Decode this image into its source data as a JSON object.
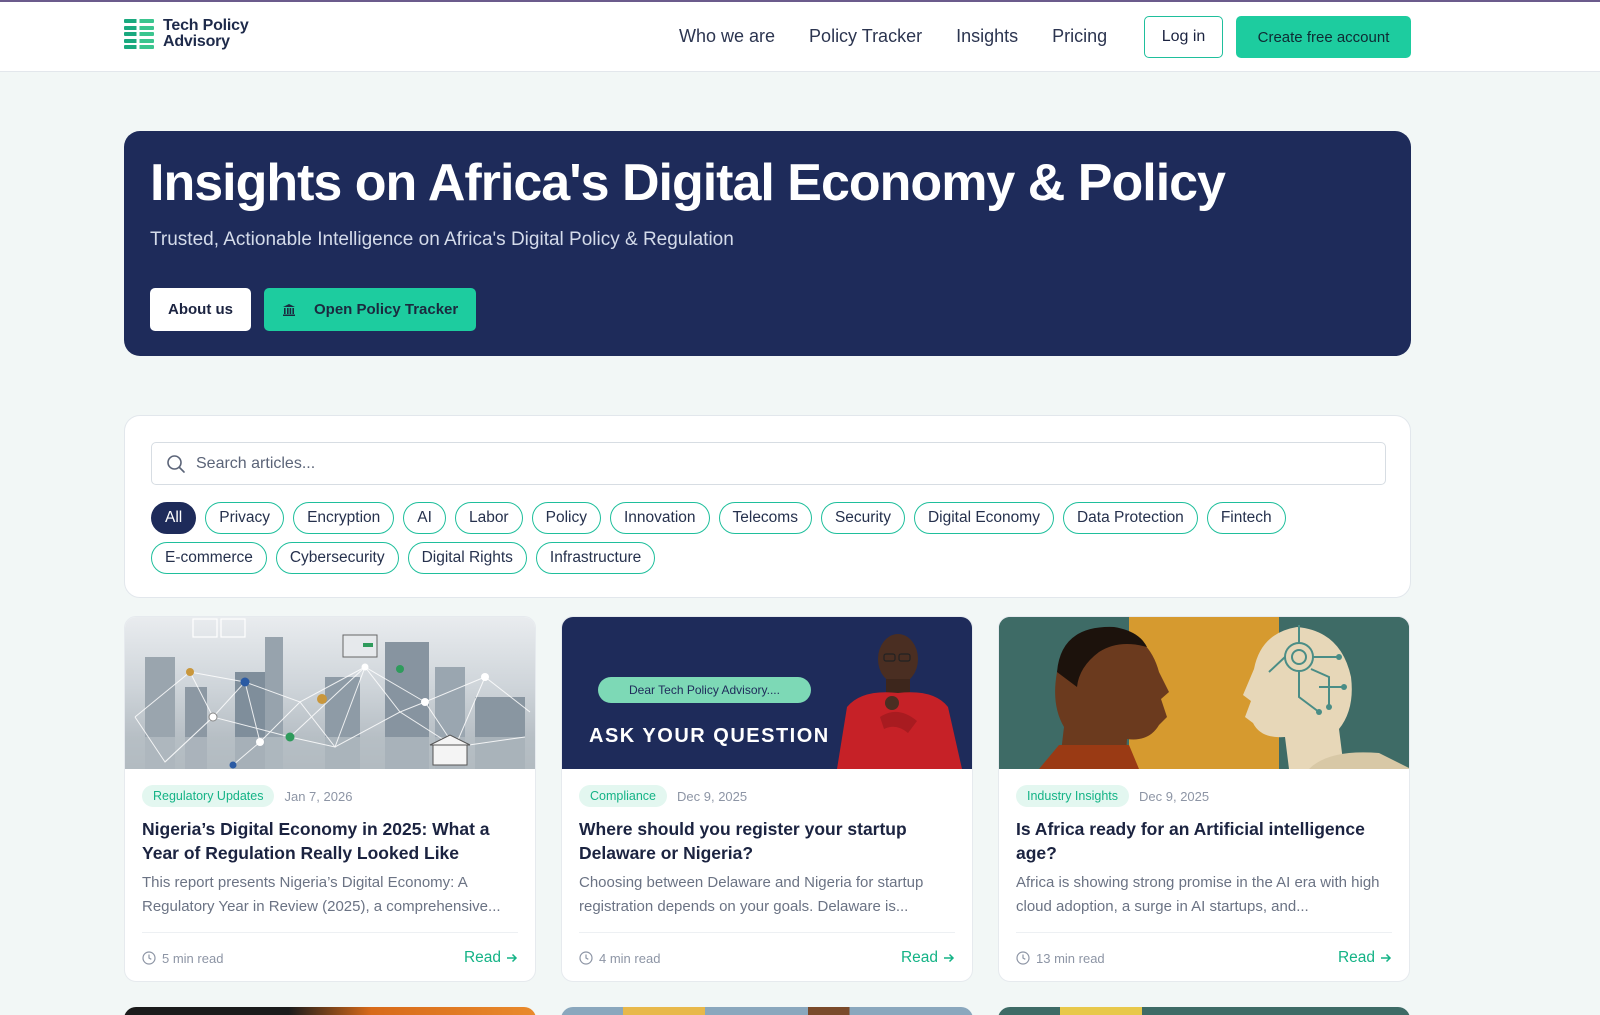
{
  "brand": {
    "name_line1": "Tech Policy",
    "name_line2": "Advisory"
  },
  "nav": {
    "items": [
      "Who we are",
      "Policy Tracker",
      "Insights",
      "Pricing"
    ],
    "login": "Log in",
    "signup": "Create free account"
  },
  "hero": {
    "title": "Insights on Africa's Digital Economy & Policy",
    "subtitle": "Trusted, Actionable Intelligence on Africa's Digital Policy & Regulation",
    "about_button": "About us",
    "tracker_button": "Open Policy Tracker"
  },
  "search": {
    "placeholder": "Search articles..."
  },
  "filters": {
    "active": "All",
    "items": [
      "All",
      "Privacy",
      "Encryption",
      "AI",
      "Labor",
      "Policy",
      "Innovation",
      "Telecoms",
      "Security",
      "Digital Economy",
      "Data Protection",
      "Fintech",
      "E-commerce",
      "Cybersecurity",
      "Digital Rights",
      "Infrastructure"
    ]
  },
  "articles": [
    {
      "category": "Regulatory Updates",
      "date": "Jan 7, 2026",
      "title": "Nigeria’s Digital Economy in 2025: What a Year of Regulation Really Looked Like",
      "excerpt": "This report presents Nigeria’s Digital Economy: A Regulatory Year in Review (2025), a comprehensive...",
      "read_time": "5 min read",
      "read_label": "Read"
    },
    {
      "category": "Compliance",
      "date": "Dec 9, 2025",
      "title": "Where should you register your startup Delaware or Nigeria?",
      "excerpt": "Choosing between Delaware and Nigeria for startup registration depends on your goals. Delaware is...",
      "read_time": "4 min read",
      "read_label": "Read",
      "image_text": {
        "pill": "Dear Tech Policy Advisory....",
        "headline": "ASK YOUR QUESTION"
      }
    },
    {
      "category": "Industry Insights",
      "date": "Dec 9, 2025",
      "title": "Is Africa ready for an Artificial intelligence age?",
      "excerpt": "Africa is showing strong promise in the AI era with high cloud adoption, a surge in AI startups, and...",
      "read_time": "13 min read",
      "read_label": "Read"
    }
  ],
  "colors": {
    "navy": "#1e2b5a",
    "accent": "#1dcc9f",
    "accent_text": "#14b386",
    "background": "#f2f7f6"
  }
}
